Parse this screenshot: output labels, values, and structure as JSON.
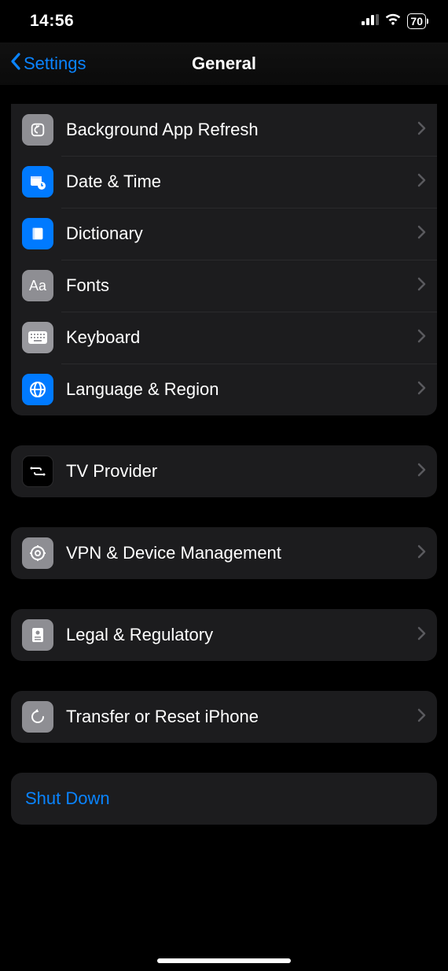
{
  "status": {
    "time": "14:56",
    "battery": "70"
  },
  "nav": {
    "back": "Settings",
    "title": "General"
  },
  "groups": [
    {
      "rows": [
        {
          "label": "Background App Refresh"
        },
        {
          "label": "Date & Time"
        },
        {
          "label": "Dictionary"
        },
        {
          "label": "Fonts"
        },
        {
          "label": "Keyboard"
        },
        {
          "label": "Language & Region"
        }
      ]
    },
    {
      "rows": [
        {
          "label": "TV Provider"
        }
      ]
    },
    {
      "rows": [
        {
          "label": "VPN & Device Management"
        }
      ]
    },
    {
      "rows": [
        {
          "label": "Legal & Regulatory"
        }
      ]
    },
    {
      "rows": [
        {
          "label": "Transfer or Reset iPhone"
        }
      ]
    },
    {
      "rows": [
        {
          "label": "Shut Down"
        }
      ]
    }
  ]
}
